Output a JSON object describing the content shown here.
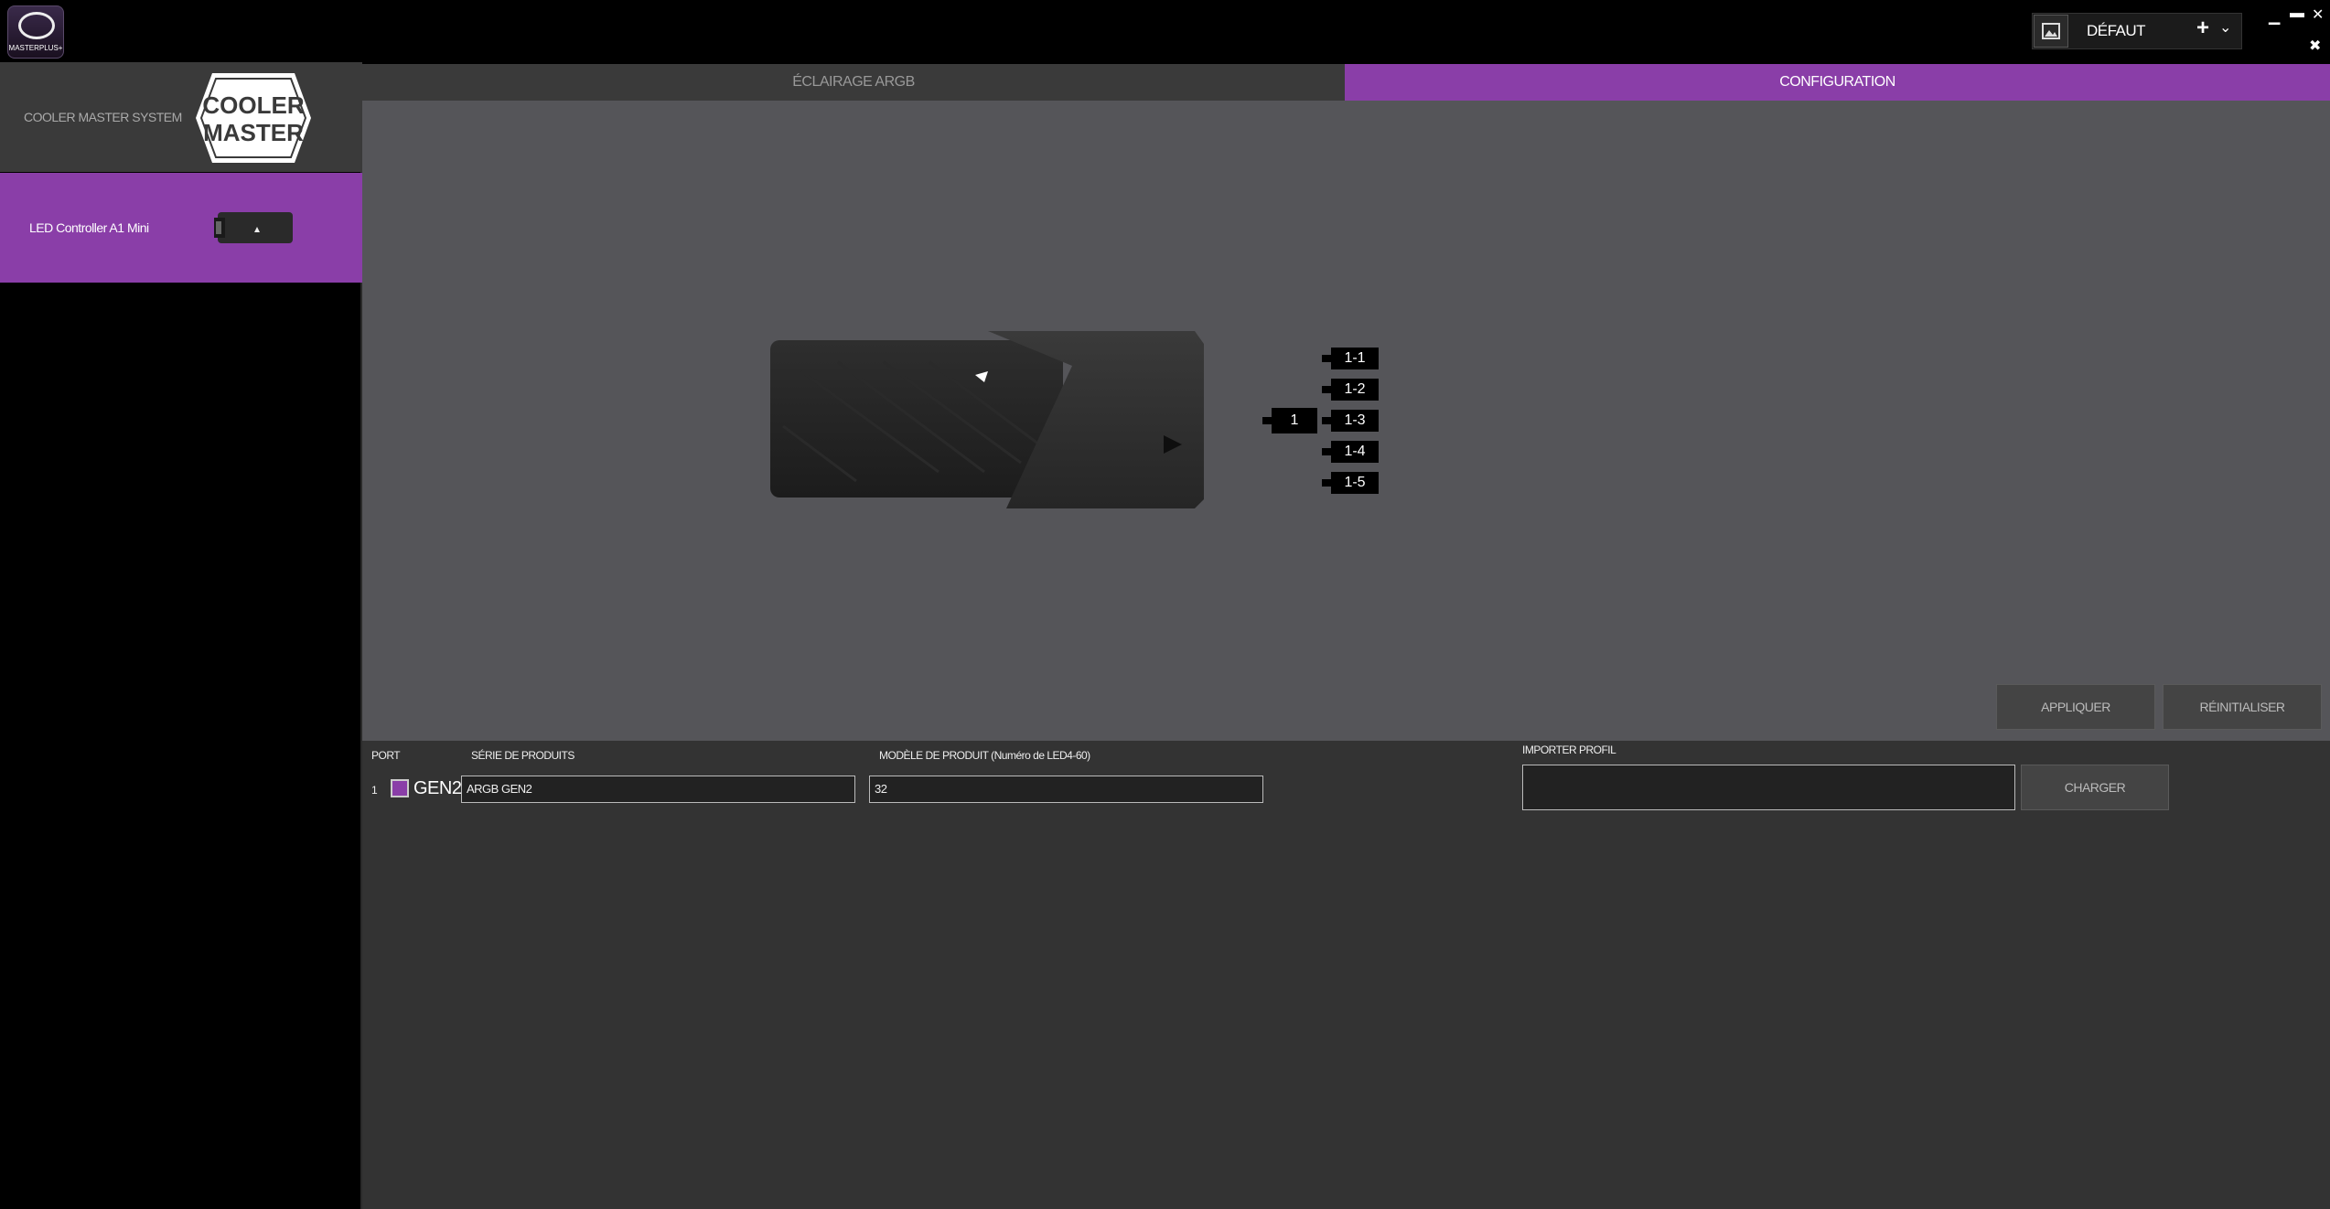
{
  "app": {
    "logo_text": "MASTERPLUS+"
  },
  "profile": {
    "name": "DÉFAUT",
    "add_icon": "plus-icon",
    "dropdown_icon": "chevron-down-icon",
    "image_icon": "image-icon"
  },
  "window": {
    "minimize": "▁",
    "maximize": "▬",
    "close": "✕",
    "pin": "✖"
  },
  "sidebar": {
    "items": [
      {
        "label": "COOLER MASTER SYSTEM",
        "logo": "cooler-master-logo"
      },
      {
        "label": "LED Controller A1 Mini",
        "image": "led-controller-image"
      }
    ]
  },
  "tabs": [
    {
      "label": "ÉCLAIRAGE ARGB",
      "active": false
    },
    {
      "label": "CONFIGURATION",
      "active": true
    }
  ],
  "device": {
    "main_port": "1",
    "sub_ports": [
      "1-1",
      "1-2",
      "1-3",
      "1-4",
      "1-5"
    ]
  },
  "actions": {
    "apply": "APPLIQUER",
    "reset": "RÉINITIALISER"
  },
  "table": {
    "headers": {
      "port": "PORT",
      "series": "SÉRIE DE PRODUITS",
      "model": "MODÈLE DE PRODUIT (Numéro de LED4-60)"
    },
    "rows": [
      {
        "port": "1",
        "swatch_color": "#8a3ea8",
        "gen": "GEN2",
        "series": "ARGB GEN2",
        "model": "32"
      }
    ]
  },
  "import": {
    "label": "IMPORTER PROFIL",
    "value": "",
    "button": "CHARGER"
  },
  "colors": {
    "accent": "#8a3ea8",
    "panel": "#555559",
    "bottom": "#333333"
  }
}
